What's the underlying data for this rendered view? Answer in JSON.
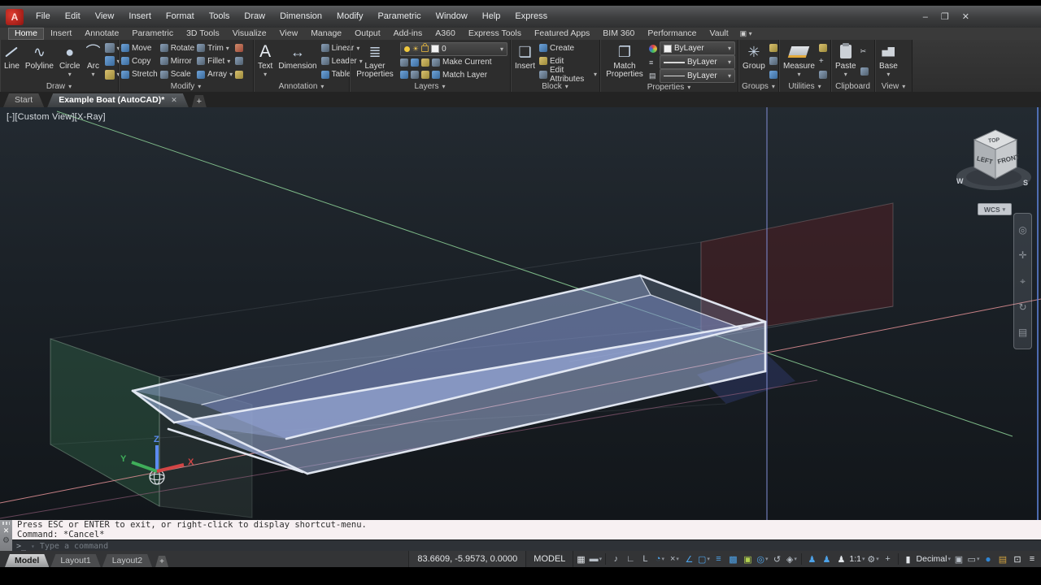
{
  "window": {
    "logo_letter": "A",
    "minimize": "–",
    "restore": "❐",
    "close": "✕"
  },
  "menus": [
    "File",
    "Edit",
    "View",
    "Insert",
    "Format",
    "Tools",
    "Draw",
    "Dimension",
    "Modify",
    "Parametric",
    "Window",
    "Help",
    "Express"
  ],
  "ribbon_tabs": [
    "Home",
    "Insert",
    "Annotate",
    "Parametric",
    "3D Tools",
    "Visualize",
    "View",
    "Manage",
    "Output",
    "Add-ins",
    "A360",
    "Express Tools",
    "Featured Apps",
    "BIM 360",
    "Performance",
    "Vault"
  ],
  "panels": {
    "draw": {
      "label": "Draw",
      "buttons": [
        "Line",
        "Polyline",
        "Circle",
        "Arc"
      ]
    },
    "modify": {
      "label": "Modify",
      "col1": [
        "Move",
        "Copy",
        "Stretch"
      ],
      "col2": [
        "Rotate",
        "Mirror",
        "Scale"
      ],
      "col3": [
        "Trim",
        "Fillet",
        "Array"
      ]
    },
    "annotation": {
      "label": "Annotation",
      "text": "Text",
      "dimension": "Dimension",
      "rows": [
        "Linear",
        "Leader",
        "Table"
      ]
    },
    "layers": {
      "label": "Layers",
      "big": "Layer Properties",
      "layer_value": "0",
      "row1": "Make Current",
      "row2": "Match Layer"
    },
    "block": {
      "label": "Block",
      "big": "Insert",
      "rows": [
        "Create",
        "Edit",
        "Edit Attributes"
      ]
    },
    "properties": {
      "label": "Properties",
      "big": "Match Properties",
      "dropdowns": [
        "ByLayer",
        "ByLayer",
        "ByLayer"
      ]
    },
    "groups": {
      "label": "Groups",
      "big": "Group"
    },
    "utilities": {
      "label": "Utilities",
      "big": "Measure"
    },
    "clipboard": {
      "label": "Clipboard",
      "big": "Paste"
    },
    "view": {
      "label": "View",
      "big": "Base"
    }
  },
  "file_tabs": {
    "start": "Start",
    "doc": "Example Boat (AutoCAD)*",
    "close": "✕",
    "new": "+"
  },
  "viewport": {
    "label": "[-][Custom View][X-Ray]",
    "viewcube": {
      "top": "TOP",
      "left": "LEFT",
      "front": "FRONT",
      "west": "W",
      "south": "S"
    },
    "wcs": "WCS",
    "ucs": {
      "x": "X",
      "y": "Y",
      "z": "Z"
    },
    "navbar_icons": [
      {
        "name": "full-navigation-wheel-icon",
        "glyph": "◎"
      },
      {
        "name": "pan-icon",
        "glyph": "✛"
      },
      {
        "name": "zoom-icon",
        "glyph": "⌖"
      },
      {
        "name": "orbit-icon",
        "glyph": "↻"
      },
      {
        "name": "showmotion-icon",
        "glyph": "▤"
      }
    ]
  },
  "command": {
    "history": [
      "Press ESC or ENTER to exit, or right-click to display shortcut-menu.",
      "Command: *Cancel*"
    ],
    "prompt": ">_",
    "placeholder": "Type a command"
  },
  "statusbar": {
    "model_tabs": [
      "Model",
      "Layout1",
      "Layout2"
    ],
    "new_tab": "+",
    "coords": "83.6609, -5.9573, 0.0000",
    "space": "MODEL",
    "annoscale": "1:1",
    "units": "Decimal",
    "icons": [
      {
        "name": "grid-display-icon",
        "glyph": "▦"
      },
      {
        "name": "snap-mode-icon",
        "glyph": "▬"
      },
      {
        "name": "dynamic-input-icon",
        "glyph": "♪"
      },
      {
        "name": "infer-constraints-icon",
        "glyph": "∟"
      },
      {
        "name": "ortho-mode-icon",
        "glyph": "L"
      },
      {
        "name": "polar-tracking-icon",
        "glyph": "◔"
      },
      {
        "name": "object-snap-icon",
        "glyph": "×"
      },
      {
        "name": "isodraft-icon",
        "glyph": "∠"
      },
      {
        "name": "autosnap-icon",
        "glyph": "▢"
      },
      {
        "name": "lineweight-icon",
        "glyph": "≡"
      },
      {
        "name": "transparency-icon",
        "glyph": "▩"
      },
      {
        "name": "selection-cycling-icon",
        "glyph": "▣"
      },
      {
        "name": "3d-object-snap-icon",
        "glyph": "◎"
      },
      {
        "name": "dynamic-ucs-icon",
        "glyph": "↺"
      },
      {
        "name": "selection-filtering-icon",
        "glyph": "◈"
      },
      {
        "name": "annotation-visibility-icon",
        "glyph": "♟"
      },
      {
        "name": "annotation-autoscale-icon",
        "glyph": "♟"
      },
      {
        "name": "annotation-scale-icon",
        "glyph": "♟"
      },
      {
        "name": "workspace-switching-icon",
        "glyph": "⚙"
      },
      {
        "name": "annotation-monitor-icon",
        "glyph": "+"
      },
      {
        "name": "units-ruler-icon",
        "glyph": "▮"
      },
      {
        "name": "quick-properties-icon",
        "glyph": "▣"
      },
      {
        "name": "graphics-performance-icon",
        "glyph": "▭"
      },
      {
        "name": "a360-connect-icon",
        "glyph": "●"
      },
      {
        "name": "share-design-view-icon",
        "glyph": "▤"
      },
      {
        "name": "clean-screen-icon",
        "glyph": "⊡"
      },
      {
        "name": "customization-icon",
        "glyph": "≡"
      }
    ]
  },
  "colors": {
    "canvas_top": "#232a31",
    "canvas_bottom": "#12161a",
    "axis_red": "#d98b90",
    "axis_green": "#8ed398",
    "axis_blue": "#7a86c8",
    "hull_fill": "#aabce0",
    "hull_edge": "#e9eef8",
    "accent_blue": "#4da2e8",
    "section_green": "#2d6e4b",
    "section_maroon": "#462123",
    "command_history_bg": "#f7f0f2"
  }
}
